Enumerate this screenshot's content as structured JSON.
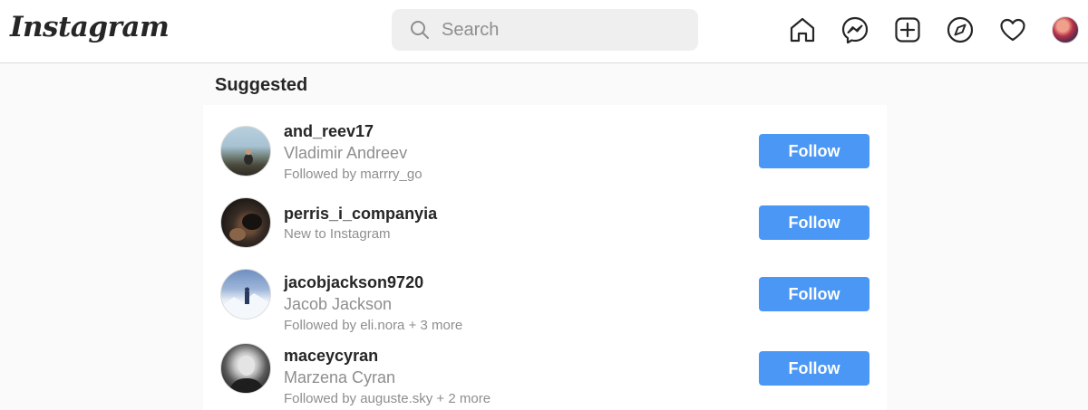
{
  "app": {
    "logo_text": "Instagram",
    "search_placeholder": "Search"
  },
  "nav": {
    "icons": [
      "home-icon",
      "messenger-icon",
      "new-post-icon",
      "explore-icon",
      "activity-heart-icon",
      "profile-avatar"
    ]
  },
  "section": {
    "heading": "Suggested"
  },
  "suggestions": [
    {
      "username": "and_reev17",
      "full_name": "Vladimir Andreev",
      "subtitle": "Followed by marrry_go",
      "button": "Follow"
    },
    {
      "username": "perris_i_companyia",
      "full_name": "",
      "subtitle": "New to Instagram",
      "button": "Follow"
    },
    {
      "username": "jacobjackson9720",
      "full_name": "Jacob Jackson",
      "subtitle": "Followed by eli.nora + 3 more",
      "button": "Follow"
    },
    {
      "username": "maceycyran",
      "full_name": "Marzena Cyran",
      "subtitle": "Followed by auguste.sky + 2 more",
      "button": "Follow"
    }
  ],
  "colors": {
    "follow_button": "#4a97f5",
    "background": "#fafafa",
    "secondary_text": "#8e8e8e"
  }
}
